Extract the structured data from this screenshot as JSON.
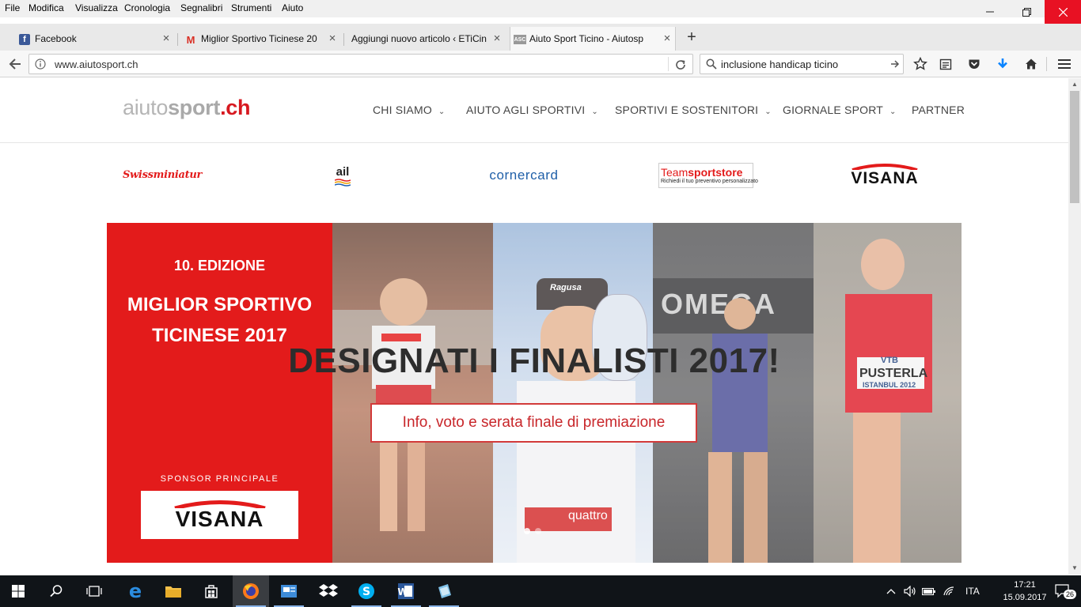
{
  "menubar": {
    "items": [
      "File",
      "Modifica",
      "Visualizza",
      "Cronologia",
      "Segnalibri",
      "Strumenti",
      "Aiuto"
    ]
  },
  "tabs": [
    {
      "title": "Facebook",
      "icon": "facebook-icon",
      "active": false
    },
    {
      "title": "Miglior Sportivo Ticinese 20",
      "icon": "gmail-icon",
      "active": false
    },
    {
      "title": "Aggiungi nuovo articolo ‹ ETiCin",
      "icon": "none",
      "active": false
    },
    {
      "title": "Aiuto Sport Ticino - Aiutosp",
      "icon": "aiutosport-icon",
      "active": true
    }
  ],
  "navbar": {
    "url": "www.aiutosport.ch",
    "search_value": "inclusione handicap ticino"
  },
  "site": {
    "logo": {
      "part1": "aiuto",
      "part2": "sport",
      "part3": ".ch"
    },
    "nav": [
      {
        "label": "CHI SIAMO",
        "dropdown": true
      },
      {
        "label": "AIUTO AGLI SPORTIVI",
        "dropdown": true
      },
      {
        "label": "SPORTIVI E SOSTENITORI",
        "dropdown": true
      },
      {
        "label": "GIORNALE SPORT",
        "dropdown": true
      },
      {
        "label": "PARTNER",
        "dropdown": false
      }
    ],
    "sponsors": {
      "swissminiatur": "Swissminiatur",
      "ail": "ail",
      "cornercard": "cornercard",
      "teamsport_1": "Team",
      "teamsport_2": "sportstore",
      "teamsport_tagline": "Richiedi il tuo preventivo personalizzato",
      "visana": "VISANA"
    },
    "hero": {
      "edition": "10. EDIZIONE",
      "title_line1": "MIGLIOR SPORTIVO",
      "title_line2": "TICINESE 2017",
      "sponsor_label": "SPONSOR PRINCIPALE",
      "sponsor_name": "VISANA",
      "headline": "DESIGNATI I FINALISTI 2017!",
      "button": "Info, voto e serata finale di premiazione",
      "photo_text_ragusa": "Ragusa",
      "photo_text_vtb": "VTB",
      "photo_text_pusterla": "PUSTERLA",
      "photo_text_istanbul": "ISTANBUL 2012",
      "photo_text_omega": "OMEGA",
      "photo_text_quattro": "quattro",
      "slides_total": 2,
      "slide_active": 1
    }
  },
  "taskbar": {
    "language": "ITA",
    "time": "17:21",
    "date": "15.09.2017",
    "notifications": "26"
  },
  "colors": {
    "brand_red": "#e31b1b",
    "close_red": "#e81123",
    "download_blue": "#0a84ff"
  }
}
